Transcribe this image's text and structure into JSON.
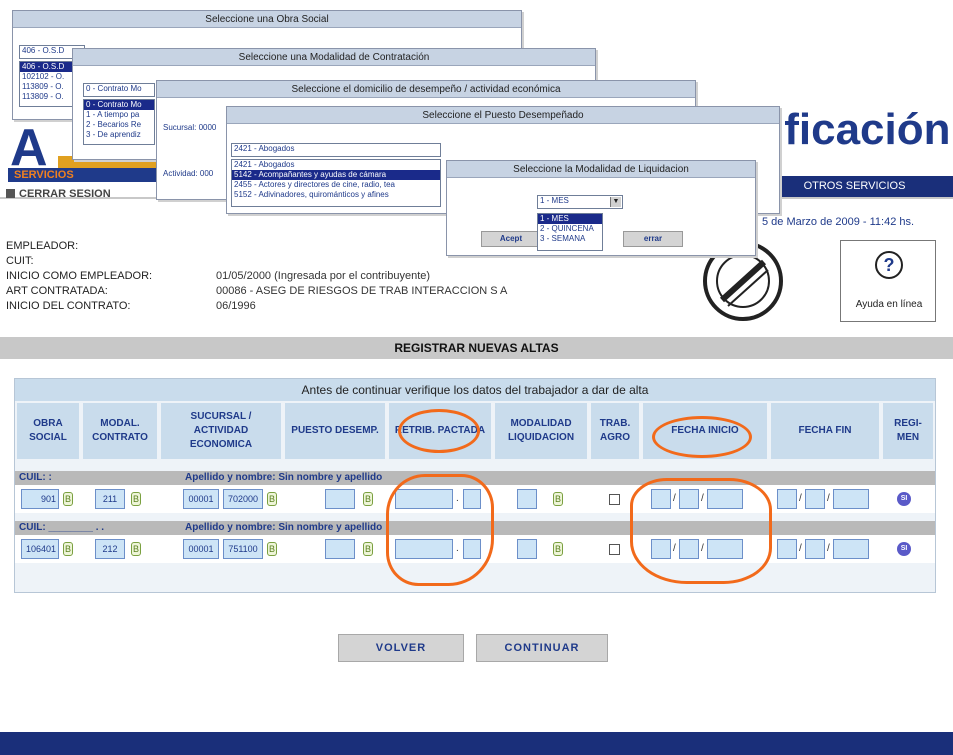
{
  "header": {
    "logo_text": "A",
    "logo_services": "SERVICIOS",
    "title_fragment": "ificación",
    "nav_label": "OTROS SERVICIOS",
    "logout_label": "CERRAR SESION",
    "datetime": "5 de Marzo de 2009 - 11:42 hs."
  },
  "employer": {
    "rows": [
      {
        "label": "EMPLEADOR:",
        "value": ""
      },
      {
        "label": "CUIT:",
        "value": ""
      },
      {
        "label": "INICIO COMO EMPLEADOR:",
        "value": "01/05/2000 (Ingresada por el contribuyente)"
      },
      {
        "label": "ART CONTRATADA:",
        "value": "00086 - ASEG DE RIESGOS DE TRAB INTERACCION S A"
      },
      {
        "label": "INICIO DEL CONTRATO:",
        "value": "06/1996"
      }
    ]
  },
  "help": {
    "icon": "question-icon",
    "label": "Ayuda en línea"
  },
  "section_title": "REGISTRAR NUEVAS ALTAS",
  "panel": {
    "title": "Antes de continuar verifique los datos del trabajador a dar de alta",
    "headers": {
      "obra_social": "OBRA SOCIAL",
      "modal_contrato": "MODAL. CONTRATO",
      "sucursal": "SUCURSAL / ACTIVIDAD ECONOMICA",
      "puesto": "PUESTO DESEMP.",
      "retrib": "RETRIB. PACTADA",
      "modalidad": "MODALIDAD LIQUIDACION",
      "trab_agro": "TRAB. AGRO",
      "fecha_inicio": "FECHA INICIO",
      "fecha_fin": "FECHA FIN",
      "regimen": "REGI-MEN"
    },
    "rows": [
      {
        "cuil": "CUIL: :",
        "name": "Apellido y nombre: Sin nombre y apellido",
        "obra": "901",
        "modal": "211",
        "suc": "00001",
        "act": "702000",
        "regimen_badge": "SI"
      },
      {
        "cuil": "CUIL: ________ . .",
        "name": "Apellido y nombre: Sin nombre y apellido",
        "obra": "106401",
        "modal": "212",
        "suc": "00001",
        "act": "751100",
        "regimen_badge": "SI"
      }
    ],
    "lookup_glyph": "B",
    "date_sep": "/",
    "decimal_sep": "."
  },
  "buttons": {
    "back": "VOLVER",
    "continue": "CONTINUAR"
  },
  "dialogs": {
    "obra_social": {
      "title": "Seleccione una Obra Social",
      "selected": "406 - O.S.D",
      "options": [
        "406 - O.S.D",
        "102102 - O.",
        "113809 - O.",
        "113809 - O."
      ]
    },
    "modalidad_contratacion": {
      "title": "Seleccione una Modalidad de Contratación",
      "selected": "0 - Contrato Mo",
      "options": [
        "0 - Contrato Mo",
        "1 - A tiempo pa",
        "2 - Becarios Re",
        "3 - De aprendiz"
      ]
    },
    "domicilio": {
      "title": "Seleccione el domicilio de desempeño / actividad económica",
      "sucursal_label": "Sucursal: 0000",
      "actividad_label": "Actividad: 000"
    },
    "puesto": {
      "title": "Seleccione el Puesto Desempeñado",
      "selected": "2421 - Abogados",
      "options": [
        "2421 - Abogados",
        "5142 - Acompañantes y ayudas de cámara",
        "2455 - Actores y directores de cine, radio, tea",
        "5152 - Adivinadores, quirománticos y afines"
      ]
    },
    "liquidacion": {
      "title": "Seleccione la Modalidad de Liquidacion",
      "selected": "1 - MES",
      "options": [
        "1 - MES",
        "2 - QUINCENA",
        "3 - SEMANA"
      ],
      "accept_label": "Acept",
      "close_label": "errar"
    }
  },
  "colors": {
    "brand_blue": "#1f3a8a",
    "annotation_orange": "#f26a1b",
    "header_band": "#c9dcec"
  }
}
